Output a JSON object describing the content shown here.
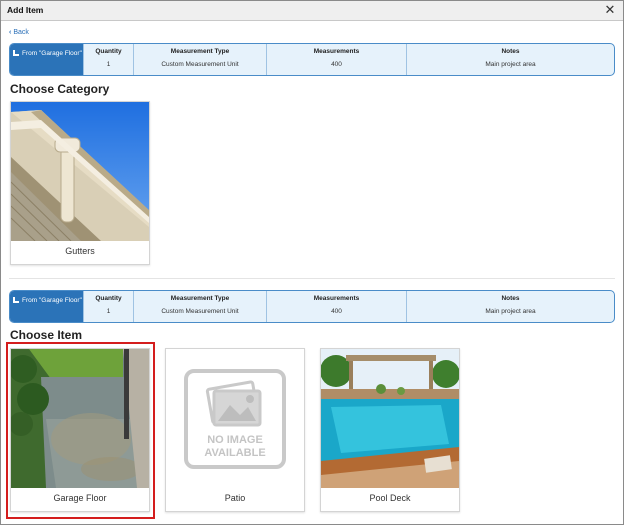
{
  "dialog": {
    "title": "Add Item",
    "close_glyph": "✕"
  },
  "nav": {
    "back_label": "Back"
  },
  "summary_bars": [
    {
      "from_label": "From \"Garage Floor\"",
      "columns": [
        {
          "header": "Quantity",
          "value": "1"
        },
        {
          "header": "Measurement Type",
          "value": "Custom Measurement Unit"
        },
        {
          "header": "Measurements",
          "value": "400"
        },
        {
          "header": "Notes",
          "value": "Main project area"
        }
      ]
    },
    {
      "from_label": "From \"Garage Floor\"",
      "columns": [
        {
          "header": "Quantity",
          "value": "1"
        },
        {
          "header": "Measurement Type",
          "value": "Custom Measurement Unit"
        },
        {
          "header": "Measurements",
          "value": "400"
        },
        {
          "header": "Notes",
          "value": "Main project area"
        }
      ]
    }
  ],
  "category_section": {
    "title": "Choose Category",
    "cards": [
      {
        "label": "Gutters",
        "image": "gutters-photo"
      }
    ]
  },
  "item_section": {
    "title": "Choose Item",
    "cards": [
      {
        "label": "Garage Floor",
        "image": "garage-floor-photo",
        "selected": true
      },
      {
        "label": "Patio",
        "image": "no-image-placeholder",
        "placeholder_line1": "NO IMAGE",
        "placeholder_line2": "AVAILABLE"
      },
      {
        "label": "Pool Deck",
        "image": "pool-deck-photo"
      }
    ]
  },
  "colors": {
    "accent": "#2b73b8",
    "summary_bg": "#e6f2fb",
    "selected_outline": "#d41d1d",
    "link": "#2a6fb8"
  }
}
